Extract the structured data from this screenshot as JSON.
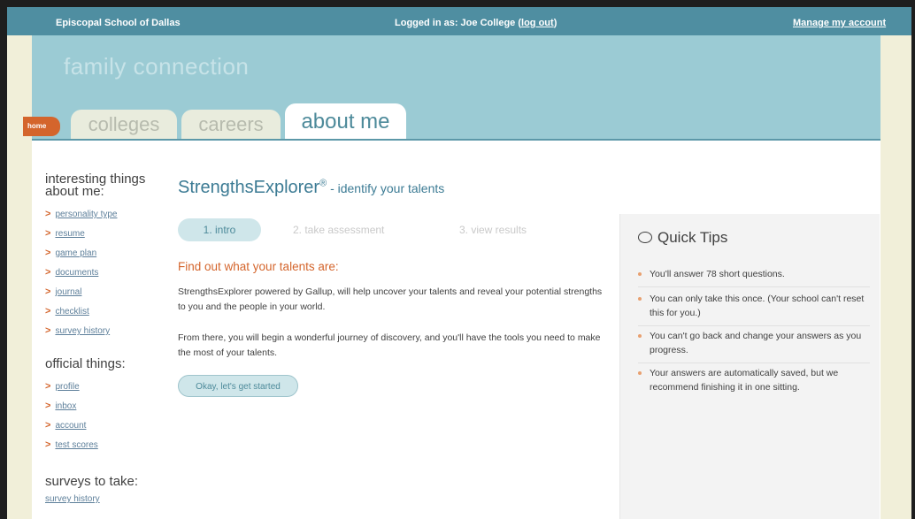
{
  "topbar": {
    "school": "Episcopal School of Dallas",
    "logged_prefix": "Logged in as: Joe College (",
    "logout": "log out",
    "logged_suffix": ")",
    "manage": "Manage my account"
  },
  "brand": "family connection",
  "tabs": {
    "home": "home",
    "colleges": "colleges",
    "careers": "careers",
    "about": "about me"
  },
  "sidebar": {
    "heading1": "interesting things about me:",
    "items1": [
      "personality type",
      "resume",
      "game plan",
      "documents",
      "journal",
      "checklist",
      "survey history"
    ],
    "heading2": "official things:",
    "items2": [
      "profile",
      "inbox",
      "account",
      "test scores"
    ],
    "heading3": "surveys to take:",
    "survey_link": "survey history"
  },
  "main": {
    "title": "StrengthsExplorer",
    "title_mark": "®",
    "title_sub": " - identify your talents",
    "steps": [
      "1. intro",
      "2. take assessment",
      "3. view results"
    ],
    "find_out": "Find out what your talents are:",
    "para1": "StrengthsExplorer powered by Gallup, will help uncover your talents and reveal your potential strengths to you and the people in your world.",
    "para2": "From there, you will begin a wonderful journey of discovery, and you'll have the tools you need to make the most of your talents.",
    "start_button": "Okay, let's get started"
  },
  "tips": {
    "title": "Quick Tips",
    "items": [
      "You'll answer 78 short questions.",
      "You can only take this once. (Your school can't reset this for you.)",
      "You can't go back and change your answers as you progress.",
      "Your answers are automatically saved, but we recommend finishing it in one sitting."
    ]
  },
  "colors": {
    "topbar": "#4f8ea1",
    "header": "#9bcbd4",
    "accent_orange": "#d4652c",
    "link_blue": "#5d7f9a"
  }
}
